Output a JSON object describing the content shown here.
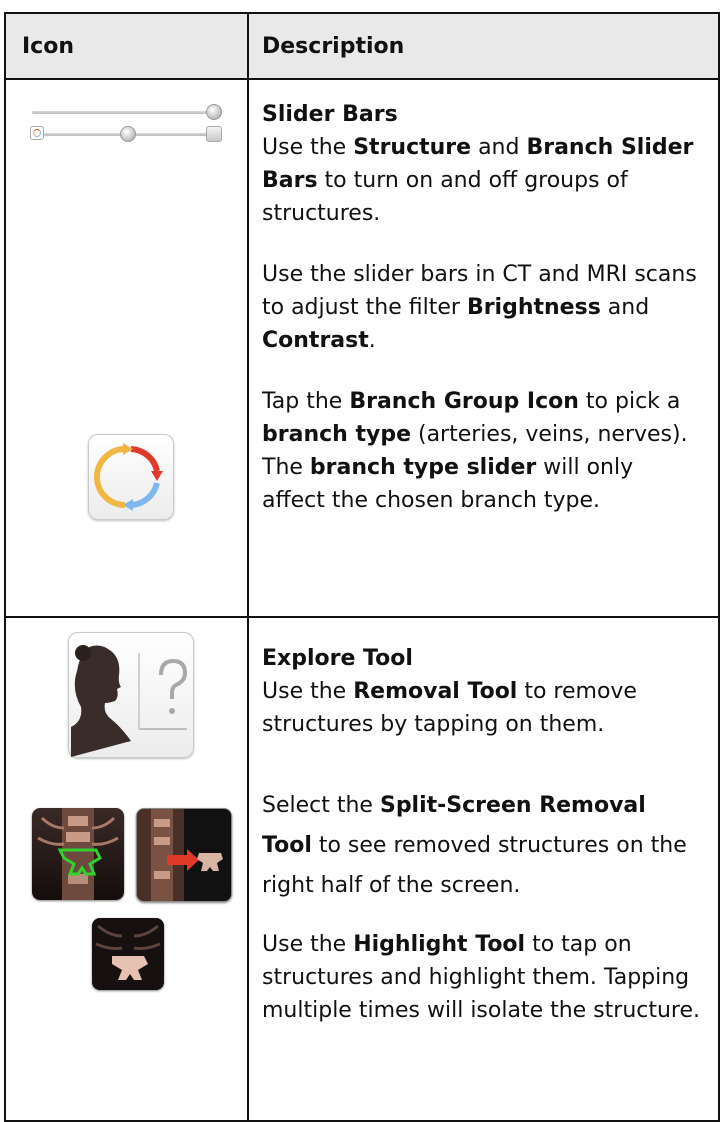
{
  "header": {
    "icon_col": "Icon",
    "description_col": "Description"
  },
  "rows": [
    {
      "title": "Slider Bars",
      "p1": {
        "a": "Use the ",
        "b1": "Structure",
        "c": " and ",
        "b2": "Branch Slider Bars",
        "d": " to turn on and off groups of structures."
      },
      "p2": {
        "a": "Use the slider bars in CT and MRI scans to adjust the filter ",
        "b1": "Brightness",
        "c": " and ",
        "b2": "Contrast",
        "d": "."
      },
      "p3": {
        "a": "Tap the ",
        "b1": "Branch Group Icon",
        "c": " to pick a ",
        "b2": "branch type",
        "d": " (arteries, veins, nerves). The ",
        "b3": "branch type slider",
        "e": " will only affect the chosen branch type."
      },
      "icons": [
        "slider-bars-icon",
        "branch-group-icon"
      ]
    },
    {
      "title": "Explore Tool",
      "p1": {
        "a": "Use the ",
        "b1": "Removal Tool",
        "c": " to remove structures by tapping on them."
      },
      "p2": {
        "a": "Select the ",
        "b1": "Split-Screen Removal Tool",
        "c": " to see removed structures on the right half of the screen."
      },
      "p3": {
        "a": "Use the ",
        "b1": "Highlight Tool",
        "c": " to tap on structures and highlight them. Tapping multiple times will isolate the structure."
      },
      "icons": [
        "explore-tool-icon",
        "removal-tool-icon",
        "split-screen-removal-icon",
        "highlight-tool-icon"
      ]
    }
  ],
  "colors": {
    "header_bg": "#e9e9e9",
    "border": "#111111",
    "arrow_red": "#e03a2a",
    "arrow_yellow": "#f0b842",
    "arrow_blue": "#7fb8ee"
  }
}
